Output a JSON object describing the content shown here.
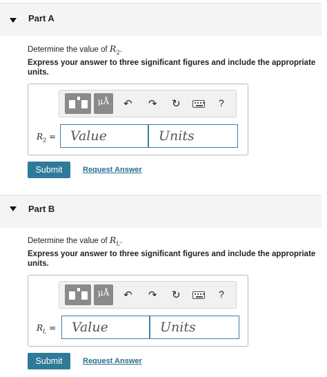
{
  "parts": [
    {
      "title": "Part A",
      "question_prefix": "Determine the value of ",
      "var_letter": "R",
      "var_sub": "2",
      "question_suffix": ".",
      "instruction": "Express your answer to three significant figures and include the appropriate units.",
      "label_letter": "R",
      "label_sub": "2",
      "label_equals": " =",
      "value_placeholder": "Value",
      "units_placeholder": "Units",
      "submit_label": "Submit",
      "request_label": "Request Answer"
    },
    {
      "title": "Part B",
      "question_prefix": "Determine the value of ",
      "var_letter": "R",
      "var_sub": "L",
      "question_suffix": ".",
      "instruction": "Express your answer to three significant figures and include the appropriate units.",
      "label_letter": "R",
      "label_sub": "L",
      "label_equals": " =",
      "value_placeholder": "Value",
      "units_placeholder": "Units",
      "submit_label": "Submit",
      "request_label": "Request Answer"
    }
  ],
  "toolbar": {
    "units_label": "μÅ",
    "undo_glyph": "↶",
    "redo_glyph": "↷",
    "reset_glyph": "↻",
    "help_label": "?",
    "icons": [
      "templates-icon",
      "units-icon",
      "undo-icon",
      "redo-icon",
      "reset-icon",
      "keyboard-icon",
      "help-icon"
    ]
  },
  "colors": {
    "header_bg": "#f4f4f4",
    "submit_bg": "#2d7a99",
    "link": "#2a6d91",
    "input_border": "#3b7ea1"
  }
}
